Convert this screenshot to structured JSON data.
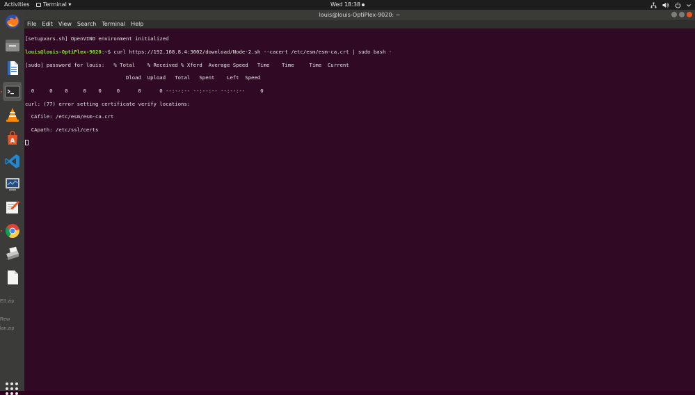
{
  "top_panel": {
    "activities": "Activities",
    "app_menu": "Terminal ▾",
    "clock": "Wed 18:38"
  },
  "window": {
    "title": "louis@louis-OptiPlex-9020: ~"
  },
  "menubar": {
    "items": [
      "File",
      "Edit",
      "View",
      "Search",
      "Terminal",
      "Help"
    ]
  },
  "terminal": {
    "line1": "[setupvars.sh] OpenVINO environment initialized",
    "prompt_user": "louis@louis-OptiPlex-9020",
    "prompt_sep": ":",
    "prompt_path": "~",
    "command": "$ curl https://192.168.8.4:3002/download/Node-2.sh --cacert /etc/esm/esm-ca.crt | sudo bash -",
    "line3": "[sudo] password for louis:   % Total    % Received % Xferd  Average Speed   Time    Time     Time  Current",
    "line4": "                                 Dload  Upload   Total   Spent    Left  Speed",
    "line5": "  0     0    0     0    0     0      0      0 --:--:-- --:--:-- --:--:--     0",
    "line6": "curl: (77) error setting certificate verify locations:",
    "line7": "  CAfile: /etc/esm/esm-ca.crt",
    "line8": "  CApath: /etc/ssl/certs"
  },
  "dock": {
    "items": [
      "firefox-icon",
      "files-icon",
      "writer-icon",
      "terminal-icon",
      "vlc-icon",
      "software-center-icon",
      "vscode-icon",
      "system-monitor-icon",
      "text-editor-icon",
      "chrome-icon",
      "scanner-icon",
      "document-icon"
    ],
    "ghost_labels": [
      "ES.zip",
      "Rew",
      "lan.zip"
    ],
    "show_apps_icon": "grid-icon"
  },
  "colors": {
    "terminal_bg": "#300a24",
    "prompt_user": "#8ae234",
    "prompt_path": "#729fcf",
    "accent": "#e95420"
  }
}
